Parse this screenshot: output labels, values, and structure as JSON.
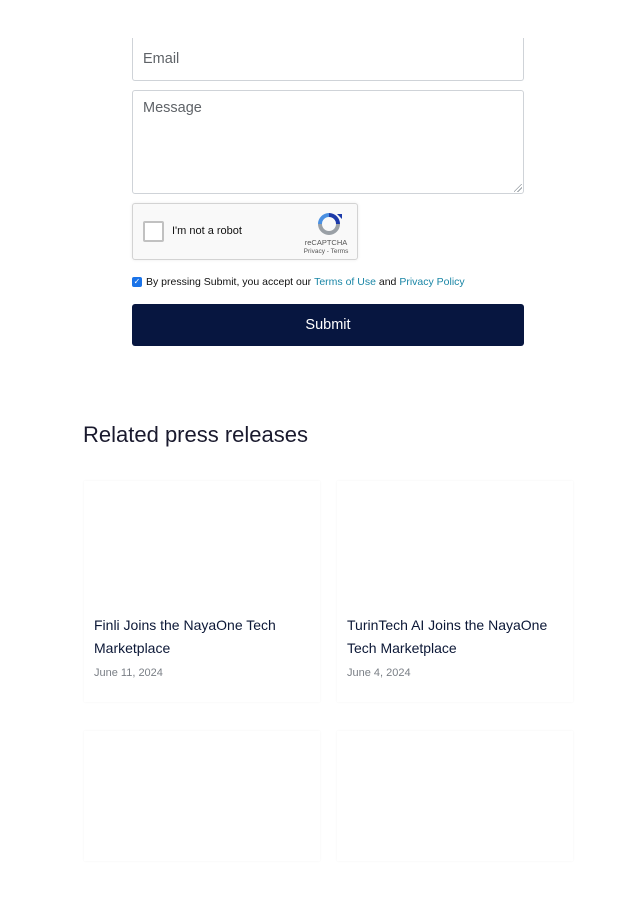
{
  "form": {
    "email_placeholder": "Email",
    "message_placeholder": "Message",
    "recaptcha": {
      "label": "I'm not a robot",
      "brand": "reCAPTCHA",
      "links": "Privacy - Terms"
    },
    "consent": {
      "prefix": "By pressing Submit, you accept our ",
      "terms": "Terms of Use",
      "and": " and ",
      "privacy": "Privacy Policy",
      "checked": true
    },
    "submit_label": "Submit"
  },
  "related": {
    "title": "Related press releases",
    "items": [
      {
        "title": "Finli Joins the NayaOne Tech Marketplace",
        "date": "June 11, 2024"
      },
      {
        "title": "TurinTech AI Joins the NayaOne Tech Marketplace",
        "date": "June 4, 2024"
      }
    ]
  },
  "colors": {
    "submit_bg": "#071640",
    "link": "#1a86a6",
    "checkbox": "#1a73e8"
  }
}
